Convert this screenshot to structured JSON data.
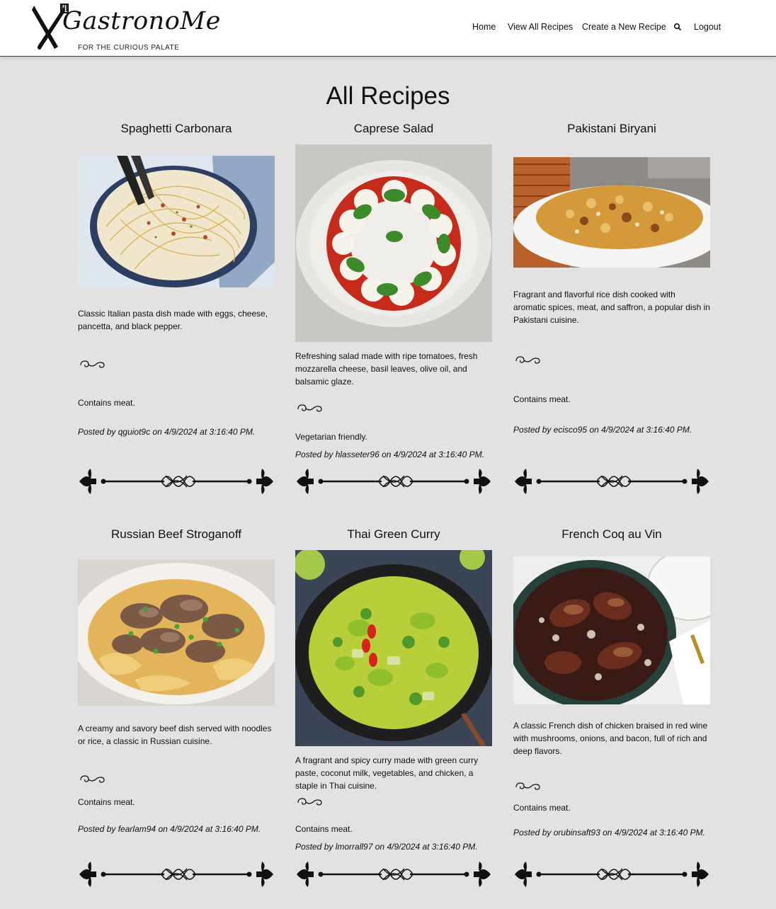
{
  "brand": {
    "name": "GastronoMe",
    "tagline": "FOR THE CURIOUS PALATE"
  },
  "nav": {
    "home": "Home",
    "view_all": "View All Recipes",
    "create": "Create a New Recipe",
    "logout": "Logout"
  },
  "page_title": "All Recipes",
  "recipes": [
    {
      "title": "Spaghetti Carbonara",
      "description": "Classic Italian pasta dish made with eggs, cheese, pancetta, and black pepper.",
      "diet": "Contains meat.",
      "author": "qguiot9c",
      "posted_on": "4/9/2024 at 3:16:40 PM."
    },
    {
      "title": "Caprese Salad",
      "description": "Refreshing salad made with ripe tomatoes, fresh mozzarella cheese, basil leaves, olive oil, and balsamic glaze.",
      "diet": "Vegetarian friendly.",
      "author": "hlasseter96",
      "posted_on": "4/9/2024 at 3:16:40 PM."
    },
    {
      "title": "Pakistani Biryani",
      "description": "Fragrant and flavorful rice dish cooked with aromatic spices, meat, and saffron, a popular dish in Pakistani cuisine.",
      "diet": "Contains meat.",
      "author": "ecisco95",
      "posted_on": "4/9/2024 at 3:16:40 PM."
    },
    {
      "title": "Russian Beef Stroganoff",
      "description": "A creamy and savory beef dish served with noodles or rice, a classic in Russian cuisine.",
      "diet": "Contains meat.",
      "author": "fearlam94",
      "posted_on": "4/9/2024 at 3:16:40 PM."
    },
    {
      "title": "Thai Green Curry",
      "description": "A fragrant and spicy curry made with green curry paste, coconut milk, vegetables, and chicken, a staple in Thai cuisine.",
      "diet": "Contains meat.",
      "author": "lmorrall97",
      "posted_on": "4/9/2024 at 3:16:40 PM."
    },
    {
      "title": "French Coq au Vin",
      "description": "A classic French dish of chicken braised in red wine with mushrooms, onions, and bacon, full of rich and deep flavors.",
      "diet": "Contains meat.",
      "author": "orubinsaft93",
      "posted_on": "4/9/2024 at 3:16:40 PM."
    }
  ],
  "labels": {
    "posted_by": "Posted by",
    "on": "on"
  },
  "icons": {
    "logo": "crossed-fork-knife-logo",
    "search": "search-icon",
    "swirl": "swirl-ornament-icon",
    "divider": "fleur-de-lis-divider"
  }
}
